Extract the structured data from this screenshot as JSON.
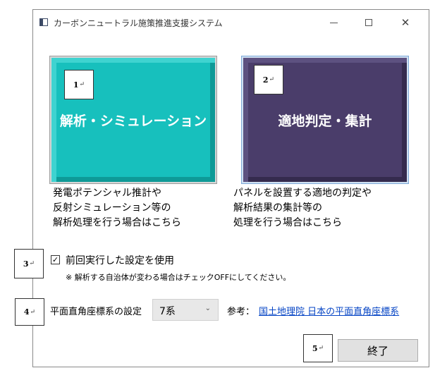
{
  "window": {
    "title": "カーボンニュートラル施策推進支援システム",
    "minimize_icon": "minimize-icon",
    "maximize_icon": "maximize-icon",
    "close_icon": "close-icon",
    "close_glyph": "✕"
  },
  "buttons": {
    "analysis": {
      "label": "解析・シミュレーション",
      "color": "#17c0bd"
    },
    "suitability": {
      "label": "適地判定・集計",
      "color": "#4a3d6a"
    },
    "exit": {
      "label": "終了"
    }
  },
  "markers": {
    "m1": "1",
    "m2": "2",
    "m3": "3",
    "m4": "4",
    "m5": "5",
    "return_mark": "↵"
  },
  "descriptions": {
    "analysis": [
      "発電ポテンシャル推計や",
      "反射シミュレーション等の",
      "解析処理を行う場合はこちら"
    ],
    "suitability": [
      "パネルを設置する適地の判定や",
      "解析結果の集計等の",
      "処理を行う場合はこちら"
    ]
  },
  "settings": {
    "checkbox_label": "前回実行した設定を使用",
    "checkbox_checked": true,
    "checkbox_glyph": "✓",
    "note": "※ 解析する自治体が変わる場合はチェックOFFにしてください。",
    "coord_label": "平面直角座標系の設定",
    "coord_value": "7系",
    "dropdown_icon": "chevron-down-icon",
    "dropdown_glyph": "⌄",
    "ref_label": "参考：",
    "ref_link": "国土地理院 日本の平面直角座標系",
    "link_color": "#0645c5"
  }
}
